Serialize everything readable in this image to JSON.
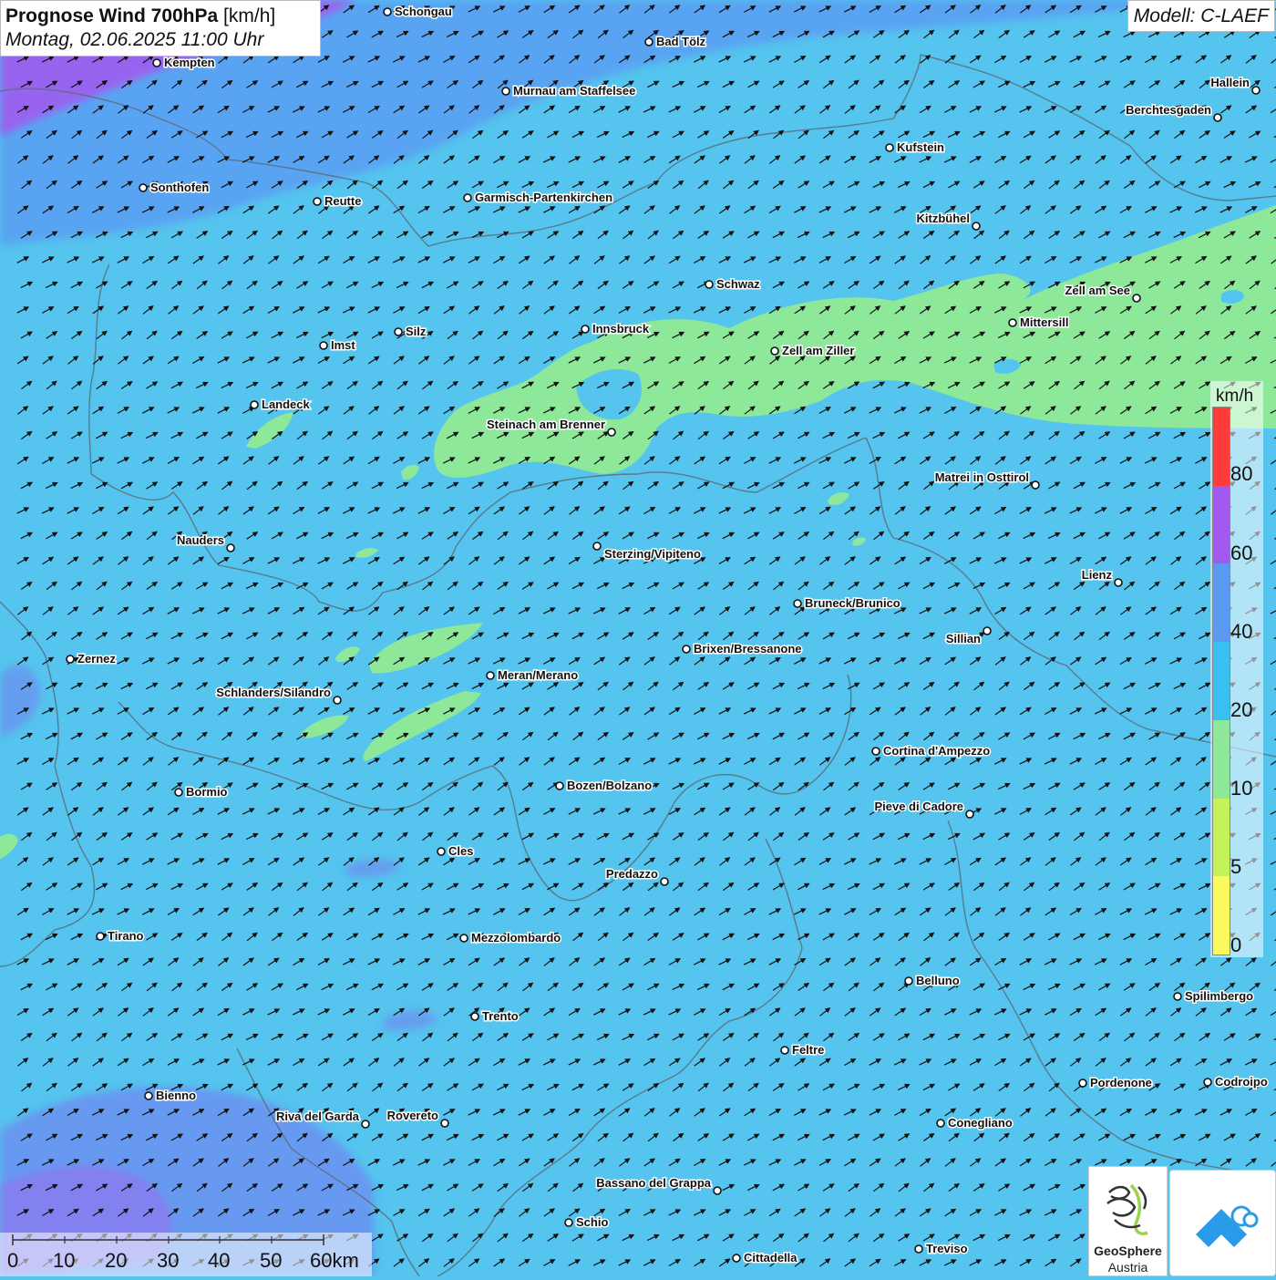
{
  "header": {
    "title_bold": "Prognose Wind 700hPa",
    "title_unit": "[km/h]",
    "datetime": "Montag, 02.06.2025 11:00 Uhr",
    "model": "Modell: C-LAEF"
  },
  "legend": {
    "unit": "km/h",
    "labels": [
      "80",
      "60",
      "40",
      "20",
      "10",
      "5",
      "0"
    ],
    "colors": [
      "#ff3b3b",
      "#a259ee",
      "#5b9af3",
      "#39c0f0",
      "#8ee89a",
      "#c3f25a",
      "#fbf95e"
    ]
  },
  "scalebar": {
    "labels": [
      "0",
      "10",
      "20",
      "30",
      "40",
      "50",
      "60km"
    ]
  },
  "logo": {
    "name_line1": "GeoSphere",
    "name_line2": "Austria"
  },
  "wind": {
    "dominant_direction": "south-west",
    "dominant_speed_class": "20-40 km/h"
  },
  "cities": [
    {
      "name": "Schongau"
    },
    {
      "name": "Bad Tölz"
    },
    {
      "name": "Kempten"
    },
    {
      "name": "Murnau am Staffelsee"
    },
    {
      "name": "Hallein"
    },
    {
      "name": "Berchtesgaden"
    },
    {
      "name": "Kufstein"
    },
    {
      "name": "Sonthofen"
    },
    {
      "name": "Reutte"
    },
    {
      "name": "Garmisch-Partenkirchen"
    },
    {
      "name": "Kitzbühel"
    },
    {
      "name": "Schwaz"
    },
    {
      "name": "Zell am See"
    },
    {
      "name": "Mittersill"
    },
    {
      "name": "Innsbruck"
    },
    {
      "name": "Silz"
    },
    {
      "name": "Imst"
    },
    {
      "name": "Zell am Ziller"
    },
    {
      "name": "Landeck"
    },
    {
      "name": "Steinach am Brenner"
    },
    {
      "name": "Matrei in Osttirol"
    },
    {
      "name": "Nauders"
    },
    {
      "name": "Sterzing/Vipiteno"
    },
    {
      "name": "Lienz"
    },
    {
      "name": "Bruneck/Brunico"
    },
    {
      "name": "Sillian"
    },
    {
      "name": "Zernez"
    },
    {
      "name": "Brixen/Bressanone"
    },
    {
      "name": "Meran/Merano"
    },
    {
      "name": "Schlanders/Silandro"
    },
    {
      "name": "Cortina d'Ampezzo"
    },
    {
      "name": "Bozen/Bolzano"
    },
    {
      "name": "Bormio"
    },
    {
      "name": "Pieve di Cadore"
    },
    {
      "name": "Cles"
    },
    {
      "name": "Predazzo"
    },
    {
      "name": "Tirano"
    },
    {
      "name": "Mezzolombardo"
    },
    {
      "name": "Belluno"
    },
    {
      "name": "Spilimbergo"
    },
    {
      "name": "Trento"
    },
    {
      "name": "Feltre"
    },
    {
      "name": "Pordenone"
    },
    {
      "name": "Codroipo"
    },
    {
      "name": "Bienno"
    },
    {
      "name": "Riva del Garda"
    },
    {
      "name": "Rovereto"
    },
    {
      "name": "Conegliano"
    },
    {
      "name": "Bassano del Grappa"
    },
    {
      "name": "Schio"
    },
    {
      "name": "Treviso"
    },
    {
      "name": "Cittadella"
    }
  ]
}
